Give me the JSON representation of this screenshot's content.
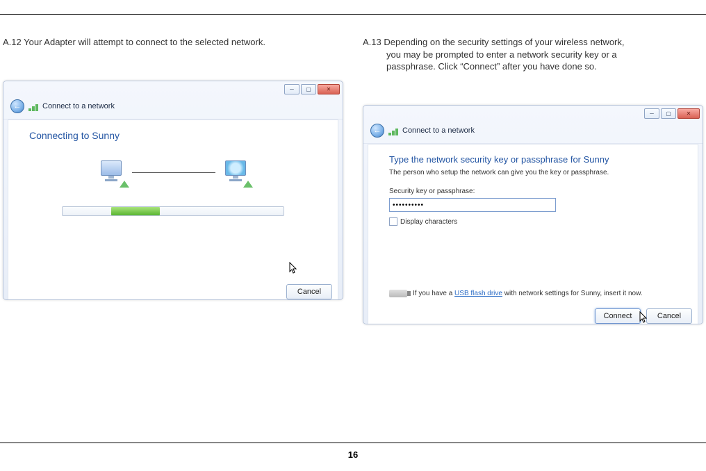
{
  "page_number": "16",
  "left": {
    "step_label": "A.12",
    "step_text": "Your Adapter will attempt to connect to the selected network.",
    "window_title": "Connect to a network",
    "heading": "Connecting to Sunny",
    "cancel_label": "Cancel"
  },
  "right": {
    "step_label": "A.13",
    "step_line1": "Depending on the security settings of your wireless network,",
    "step_line2": "you may be prompted to enter a network security key or a",
    "step_line3": "passphrase. Click “Connect” after you have done so.",
    "window_title": "Connect to a network",
    "heading": "Type the network security key or passphrase for Sunny",
    "helper": "The person who setup the network can give you the key or passphrase.",
    "field_label": "Security key or passphrase:",
    "field_value": "••••••••••",
    "display_chars_label": "Display characters",
    "usb_prefix": "If you have a ",
    "usb_link": "USB flash drive",
    "usb_suffix": " with network settings for Sunny, insert it now.",
    "connect_label": "Connect",
    "cancel_label": "Cancel"
  }
}
